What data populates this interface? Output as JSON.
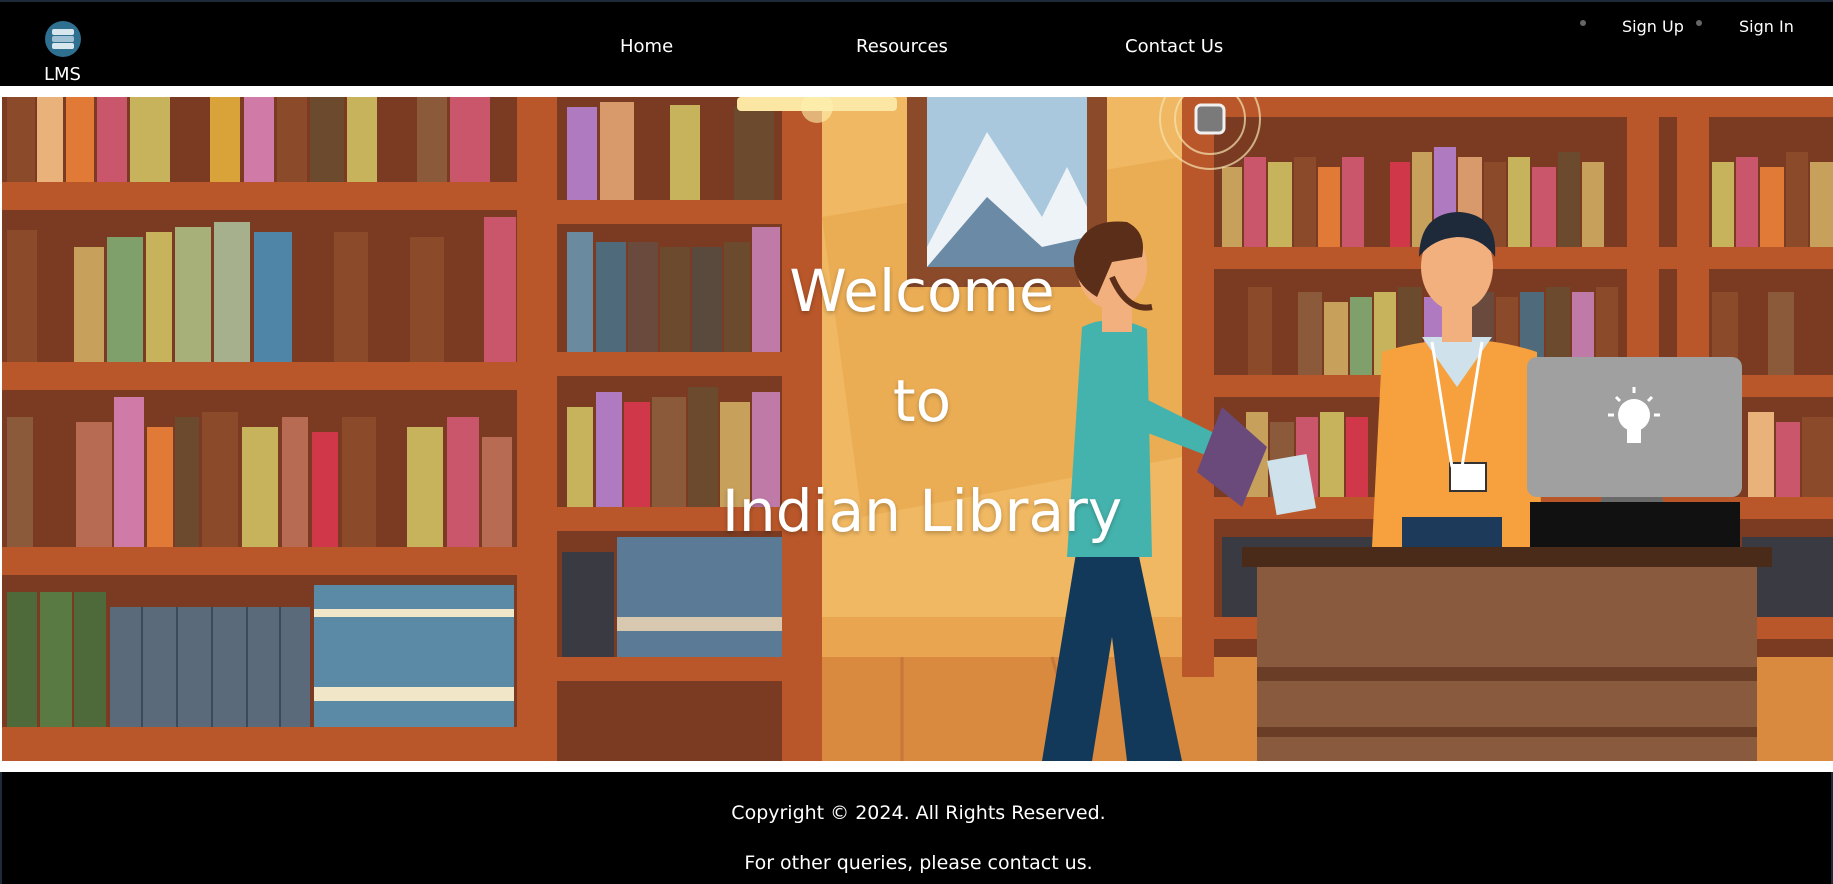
{
  "navbar": {
    "logo_text": "LMS",
    "links": [
      {
        "label": "Home"
      },
      {
        "label": "Resources"
      },
      {
        "label": "Contact Us"
      }
    ],
    "auth": {
      "signup": "Sign Up",
      "signin": "Sign In"
    }
  },
  "hero": {
    "line1": "Welcome",
    "line2": "to",
    "line3": "Indian Library"
  },
  "footer": {
    "copyright": "Copyright © 2024. All Rights Reserved.",
    "queries": "For other queries, please contact us."
  },
  "colors": {
    "navbar_bg": "#000000",
    "footer_bg": "#000000",
    "hero_wall": "#e7a14b",
    "shelf_wood": "#b9572a",
    "text_white": "#ffffff"
  },
  "icons": [
    "library-logo-icon",
    "rfid-chip-icon",
    "lightbulb-icon"
  ]
}
